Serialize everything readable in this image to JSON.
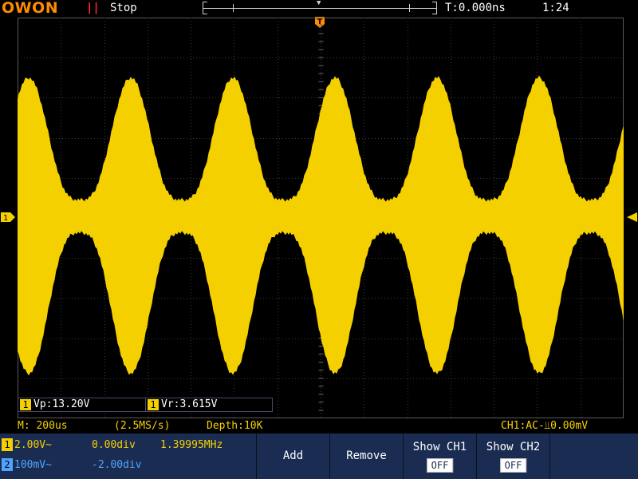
{
  "brand": {
    "logo_text": "OWON"
  },
  "header": {
    "run_icon": "pause-icon",
    "run_glyph": "||",
    "run_status": "Stop",
    "trigger_time": "T:0.000ns",
    "clock": "1:24"
  },
  "waveform": {
    "color": "#f5d000",
    "grid_color": "#3c3c3c",
    "horizontal_divisions": 14,
    "vertical_divisions": 10
  },
  "measurements": {
    "vp": {
      "channel": "1",
      "text": "Vp:13.20V"
    },
    "vr": {
      "channel": "1",
      "text": "Vr:3.615V"
    }
  },
  "status": {
    "timebase": "M: 200us",
    "sample_rate": "(2.5MS/s)",
    "depth": "Depth:10K",
    "trigger": "CH1:AC-⫫0.00mV"
  },
  "channels": {
    "ch1": {
      "num": "1",
      "scale": "2.00V~",
      "offset": "0.00div",
      "frequency": "1.39995MHz",
      "color": "#f5d000"
    },
    "ch2": {
      "num": "2",
      "scale": "100mV~",
      "offset": "-2.00div",
      "color": "#4fa4ff"
    }
  },
  "softkeys": {
    "add": "Add",
    "remove": "Remove",
    "show_ch1": {
      "label": "Show CH1",
      "state": "OFF"
    },
    "show_ch2": {
      "label": "Show CH2",
      "state": "OFF"
    }
  },
  "markers": {
    "ch1_level": "1",
    "trigger_position": "T"
  }
}
